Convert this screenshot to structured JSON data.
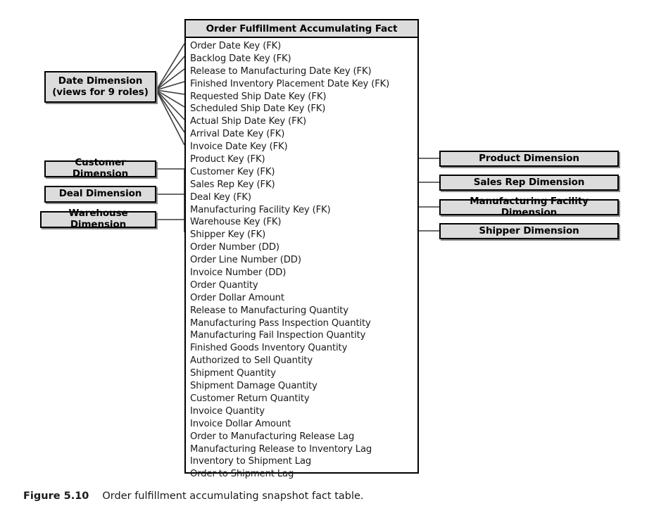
{
  "figure": {
    "number": "Figure 5.10",
    "caption": "Order fulfillment accumulating snapshot fact table."
  },
  "fact_table": {
    "title": "Order Fulfillment Accumulating Fact",
    "rows": [
      "Order Date Key (FK)",
      "Backlog Date Key (FK)",
      "Release to Manufacturing Date Key (FK)",
      "Finished Inventory Placement Date Key (FK)",
      "Requested Ship Date Key (FK)",
      "Scheduled Ship Date Key (FK)",
      "Actual Ship Date Key (FK)",
      "Arrival Date Key (FK)",
      "Invoice Date Key (FK)",
      "Product Key (FK)",
      "Customer Key (FK)",
      "Sales Rep Key (FK)",
      "Deal Key (FK)",
      "Manufacturing Facility Key (FK)",
      "Warehouse Key (FK)",
      "Shipper Key (FK)",
      "Order Number (DD)",
      "Order Line Number (DD)",
      "Invoice Number (DD)",
      "Order Quantity",
      "Order Dollar Amount",
      "Release to Manufacturing Quantity",
      "Manufacturing Pass Inspection Quantity",
      "Manufacturing Fail Inspection Quantity",
      "Finished Goods Inventory Quantity",
      "Authorized to Sell Quantity",
      "Shipment Quantity",
      "Shipment Damage Quantity",
      "Customer Return Quantity",
      "Invoice Quantity",
      "Invoice Dollar Amount",
      "Order to Manufacturing Release Lag",
      "Manufacturing Release to Inventory Lag",
      "Inventory to Shipment Lag",
      "Order to Shipment Lag"
    ]
  },
  "left_dimensions": [
    {
      "label": "Date Dimension",
      "sublabel": "(views for 9 roles)"
    },
    {
      "label": "Customer Dimension",
      "sublabel": ""
    },
    {
      "label": "Deal Dimension",
      "sublabel": ""
    },
    {
      "label": "Warehouse Dimension",
      "sublabel": ""
    }
  ],
  "right_dimensions": [
    {
      "label": "Product Dimension"
    },
    {
      "label": "Sales Rep Dimension"
    },
    {
      "label": "Manufacturing Facility Dimension"
    },
    {
      "label": "Shipper Dimension"
    }
  ],
  "colors": {
    "box_fill": "#dcdcdc",
    "box_border": "#000000",
    "table_fill": "#ffffff",
    "connector": "#3c3c3c",
    "text": "#1a1a1a",
    "background": "#ffffff"
  }
}
